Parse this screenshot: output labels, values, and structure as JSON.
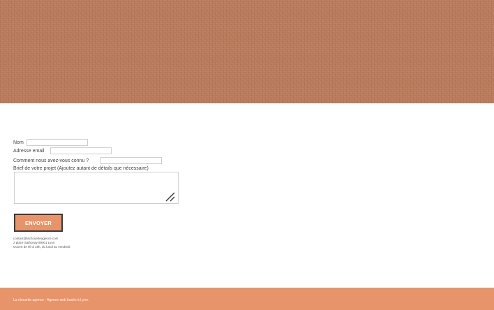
{
  "colors": {
    "header_background": "#b9795a",
    "accent": "#e8946b",
    "button_border": "#3a3a3a",
    "footer_text": "#fff4ec"
  },
  "form": {
    "name_label": "Nom",
    "name_value": "",
    "email_label": "Adresse email",
    "email_value": "",
    "referral_label": "Comment nous avez-vous connu ?",
    "referral_value": "",
    "brief_label": "Brief de votre projet (Ajoutez autant de détails que nécessaire)",
    "brief_value": "",
    "submit_label": "ENVOYER"
  },
  "contact": {
    "email": "contact@lachouetteagence.com",
    "address": "2 place Sathonay 69001 Lyon",
    "hours": "Ouvert de 9h à 18h, du lundi au vendredi"
  },
  "footer": {
    "text": "La chouette agence - Agence web basée à Lyon."
  }
}
